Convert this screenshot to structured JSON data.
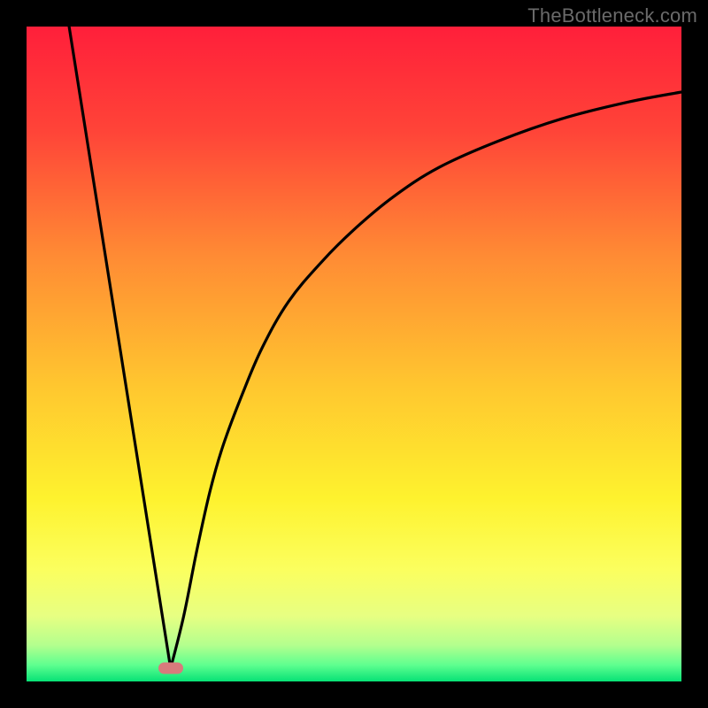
{
  "watermark": "TheBottleneck.com",
  "marker": {
    "color": "#d87a7c"
  },
  "chart_data": {
    "type": "line",
    "title": "",
    "xlabel": "",
    "ylabel": "",
    "xlim": [
      0,
      100
    ],
    "ylim": [
      0,
      100
    ],
    "gradient_stops": [
      {
        "offset": 0.0,
        "color": "#ff1f3a"
      },
      {
        "offset": 0.16,
        "color": "#ff4438"
      },
      {
        "offset": 0.35,
        "color": "#ff8b34"
      },
      {
        "offset": 0.55,
        "color": "#ffc72f"
      },
      {
        "offset": 0.72,
        "color": "#fef22e"
      },
      {
        "offset": 0.83,
        "color": "#fbff5f"
      },
      {
        "offset": 0.9,
        "color": "#e7ff82"
      },
      {
        "offset": 0.945,
        "color": "#b3ff8e"
      },
      {
        "offset": 0.975,
        "color": "#5eff8f"
      },
      {
        "offset": 1.0,
        "color": "#07e276"
      }
    ],
    "marker_point": {
      "x": 22,
      "y": 2
    },
    "series": [
      {
        "name": "left-branch",
        "x": [
          6.5,
          22
        ],
        "y": [
          100,
          2
        ]
      },
      {
        "name": "right-branch",
        "x": [
          22,
          24,
          26,
          28,
          30,
          33,
          36,
          40,
          45,
          50,
          56,
          63,
          72,
          82,
          92,
          100
        ],
        "y": [
          2,
          10,
          20,
          29,
          36,
          44,
          51,
          58,
          64,
          69,
          74,
          78.5,
          82.5,
          86,
          88.5,
          90
        ]
      }
    ]
  }
}
